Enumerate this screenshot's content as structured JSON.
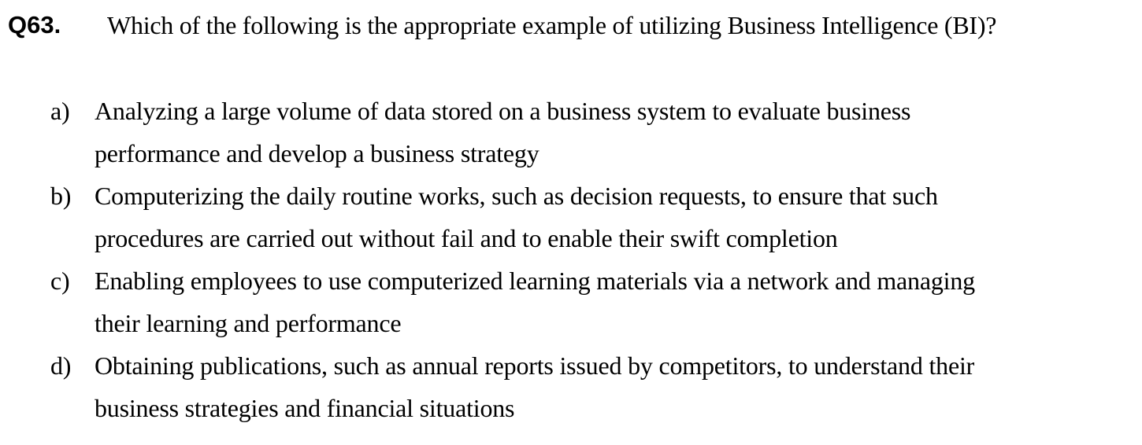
{
  "question": {
    "number": "Q63.",
    "text": "Which of the following is the appropriate example of utilizing Business Intelligence (BI)?"
  },
  "options": [
    {
      "letter": "a)",
      "line1": "Analyzing a large volume of data stored on a business system to evaluate business",
      "line2": "performance and develop a business strategy"
    },
    {
      "letter": "b)",
      "line1": "Computerizing the daily routine works, such as decision requests, to ensure that such",
      "line2": "procedures are carried out without fail and to enable their swift completion"
    },
    {
      "letter": "c)",
      "line1": "Enabling employees to use computerized learning materials via a network and managing",
      "line2": "their learning and performance"
    },
    {
      "letter": "d)",
      "line1": "Obtaining publications, such as annual reports issued by competitors, to understand their",
      "line2": "business strategies and financial situations"
    }
  ]
}
